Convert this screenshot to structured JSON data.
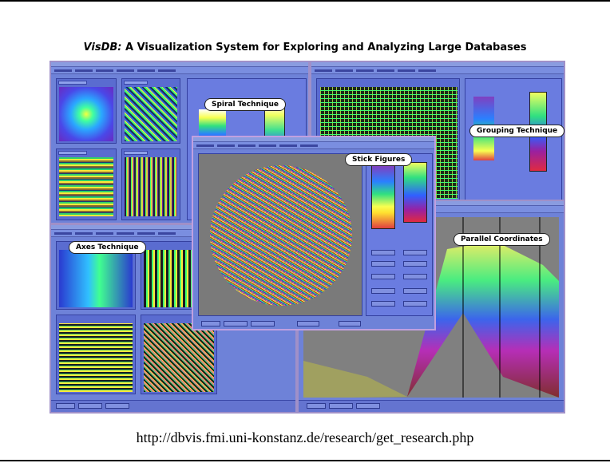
{
  "title": {
    "brand": "VisDB:",
    "rest": "A Visualization System for Exploring and Analyzing Large Databases"
  },
  "callouts": {
    "spiral": "Spiral Technique",
    "grouping": "Grouping Technique",
    "stick": "Stick Figures",
    "axes": "Axes Technique",
    "parallel": "Parallel Coordinates"
  },
  "url": "http://dbvis.fmi.uni-konstanz.de/research/get_research.php",
  "colors": {
    "window": "#6e82d8",
    "border": "#a090c8",
    "viz_bg": "#808080"
  }
}
